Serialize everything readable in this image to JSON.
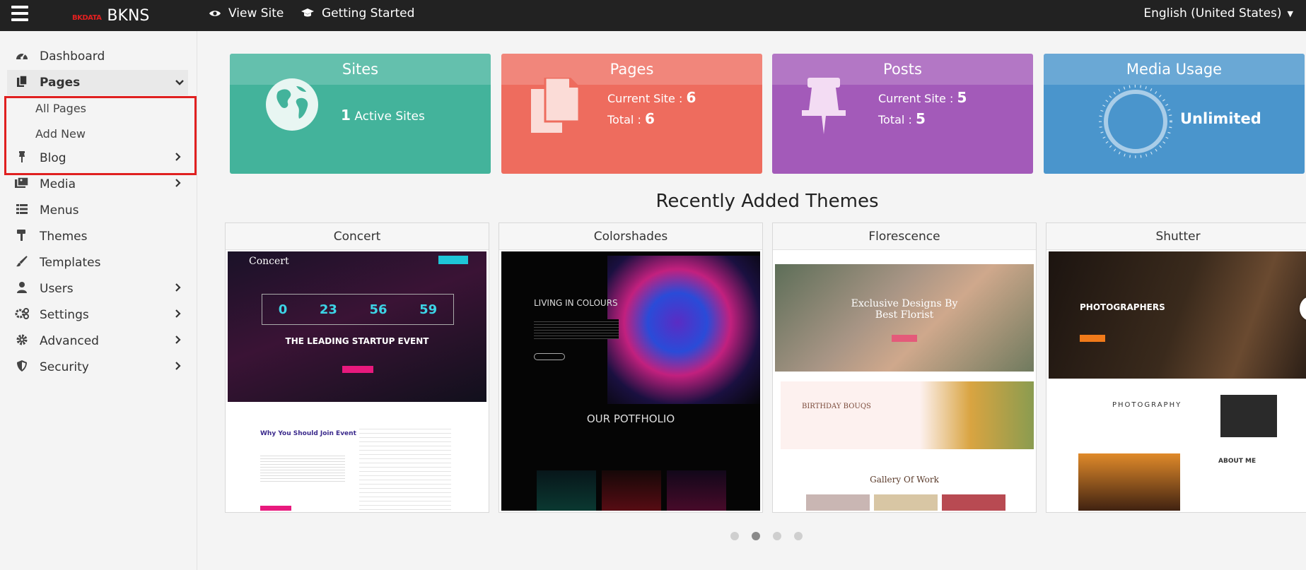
{
  "topbar": {
    "logo_mark": "BKDATA",
    "brand": "BKNS",
    "view_site": "View Site",
    "getting_started": "Getting Started",
    "language": "English (United States)"
  },
  "sidebar": {
    "items": [
      {
        "label": "Dashboard",
        "icon": "dashboard-icon"
      },
      {
        "label": "Pages",
        "icon": "pages-icon",
        "expanded": true
      },
      {
        "label": "Blog",
        "icon": "pin-icon"
      },
      {
        "label": "Media",
        "icon": "media-icon"
      },
      {
        "label": "Menus",
        "icon": "list-icon"
      },
      {
        "label": "Themes",
        "icon": "paint-roller-icon"
      },
      {
        "label": "Templates",
        "icon": "brush-icon"
      },
      {
        "label": "Users",
        "icon": "user-icon"
      },
      {
        "label": "Settings",
        "icon": "cogs-icon"
      },
      {
        "label": "Advanced",
        "icon": "gear-icon"
      },
      {
        "label": "Security",
        "icon": "shield-icon"
      }
    ],
    "pages_sub": [
      "All Pages",
      "Add New"
    ]
  },
  "cards": {
    "sites": {
      "title": "Sites",
      "count": "1",
      "text": "Active Sites",
      "color": "#43b39b"
    },
    "pages": {
      "title": "Pages",
      "current_label": "Current Site :",
      "current_value": "6",
      "total_label": "Total :",
      "total_value": "6",
      "color": "#ee6c5e"
    },
    "posts": {
      "title": "Posts",
      "current_label": "Current Site :",
      "current_value": "5",
      "total_label": "Total :",
      "total_value": "5",
      "color": "#a35ab9"
    },
    "media": {
      "title": "Media Usage",
      "value": "Unlimited",
      "color": "#4a95cc"
    }
  },
  "themes_section": {
    "title": "Recently Added Themes",
    "themes": [
      {
        "name": "Concert",
        "hero_title": "Concert",
        "hero_heading": "THE LEADING STARTUP EVENT",
        "counters": [
          "0",
          "23",
          "56",
          "59"
        ],
        "lower_heading": "Why You Should Join Event"
      },
      {
        "name": "Colorshades",
        "hero_heading": "LIVING IN COLOURS",
        "lower_heading": "OUR POTFHOLIO"
      },
      {
        "name": "Florescence",
        "hero_heading": "Exclusive Designs By Best Florist",
        "banner_heading": "BIRTHDAY BOUQS",
        "lower_heading": "Gallery Of Work"
      },
      {
        "name": "Shutter",
        "hero_heading": "PHOTOGRAPHERS",
        "mid_heading": "PHOTOGRAPHY",
        "about_heading": "ABOUT ME"
      }
    ],
    "carousel_pages": 4,
    "active_page": 2
  }
}
